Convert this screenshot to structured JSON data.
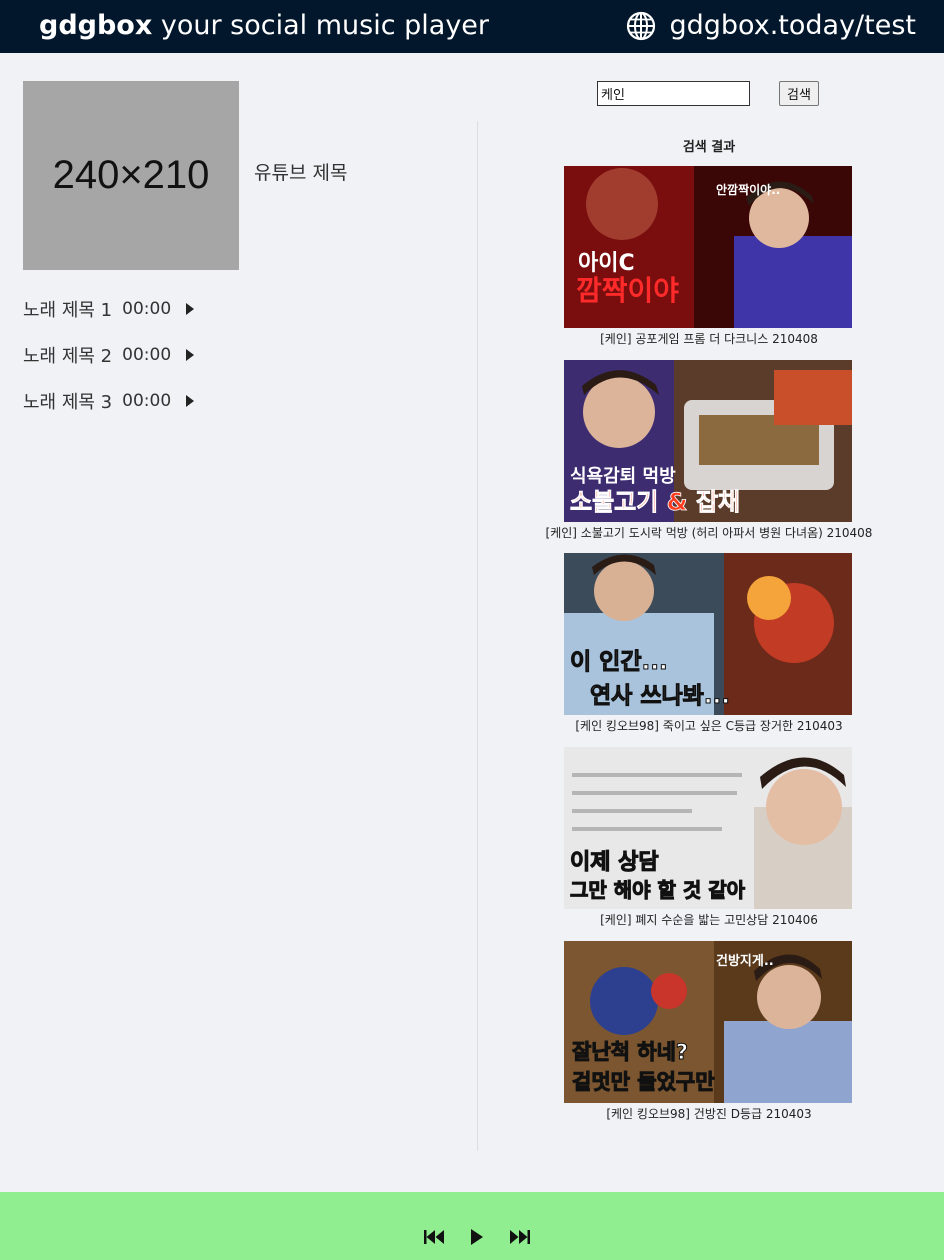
{
  "header": {
    "brand_name": "gdgbox",
    "brand_tagline": "your social music player",
    "room_url": "gdgbox.today/test"
  },
  "current": {
    "thumbnail_placeholder": "240×210",
    "youtube_title": "유튜브 제목"
  },
  "playlist": [
    {
      "title": "노래 제목 1",
      "time": "00:00"
    },
    {
      "title": "노래 제목 2",
      "time": "00:00"
    },
    {
      "title": "노래 제목 3",
      "time": "00:00"
    }
  ],
  "search": {
    "query": "케인",
    "button_label": "검색",
    "results_heading": "검색 결과"
  },
  "results": [
    {
      "caption": "[케인] 공포게임 프롬 더 다크니스 210408",
      "thumb_text": [
        "아이C",
        "깜짝이야"
      ],
      "thumb_bubble": "안깜짝이야.."
    },
    {
      "caption": "[케인] 소불고기 도시락 먹방 (허리 아파서 병원 다녀옴) 210408",
      "thumb_text": [
        "식욕감퇴 먹방",
        "소불고기 & 잡채"
      ],
      "thumb_bubble": ""
    },
    {
      "caption": "[케인 킹오브98] 죽이고 싶은 C등급 장거한 210403",
      "thumb_text": [
        "이 인간...",
        "연사 쓰나봐..."
      ],
      "thumb_bubble": ""
    },
    {
      "caption": "[케인] 폐지 수순을 밟는 고민상담 210406",
      "thumb_text": [
        "이제 상담",
        "그만 해야 할 것 같아"
      ],
      "thumb_bubble": ""
    },
    {
      "caption": "[케인 킹오브98] 건방진 D등급 210403",
      "thumb_text": [
        "잘난척 하네?",
        "겉멋만 들었구만"
      ],
      "thumb_bubble": "건방지게.."
    }
  ],
  "icons": {
    "globe": "globe-icon",
    "play": "play-icon",
    "prev": "skip-back-icon",
    "next": "skip-forward-icon"
  },
  "colors": {
    "header_bg": "#02172b",
    "page_bg": "#f0f2f5",
    "player_bg": "#90ee90"
  }
}
